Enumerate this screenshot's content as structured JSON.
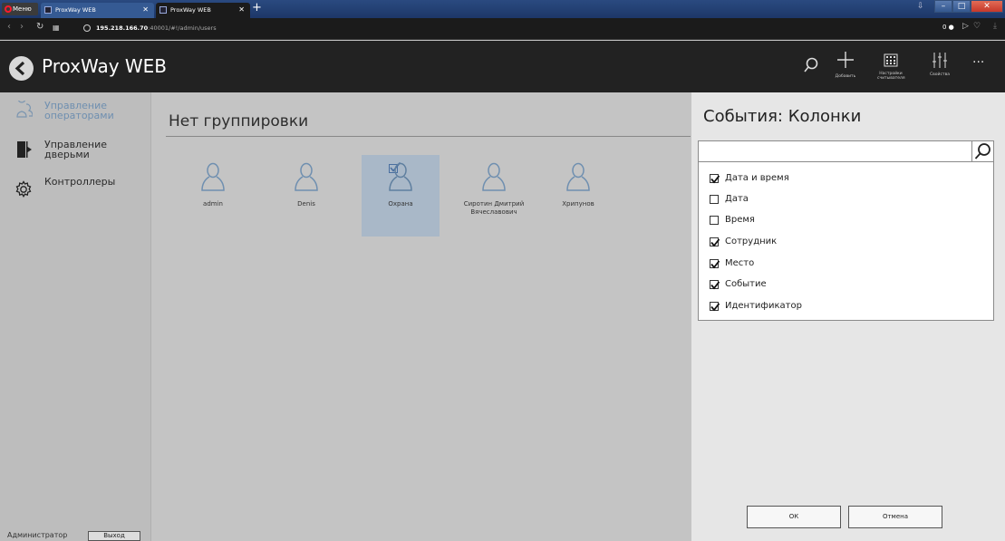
{
  "browser": {
    "menu_label": "Меню",
    "tabs": [
      {
        "title": "ProxWay WEB"
      },
      {
        "title": "ProxWay WEB"
      }
    ],
    "new_tab": "+",
    "address": {
      "host": "195.218.166.70",
      "rest": ":40001/#!/admin/users"
    }
  },
  "app": {
    "title": "ProxWay WEB",
    "toolbar": {
      "search_icon": "search-icon",
      "add_label": "Добавить",
      "reader_label": "Настройки считывателя",
      "props_label": "Свойства",
      "more_label": "···"
    }
  },
  "sidebar": {
    "items": [
      {
        "label": "Управление операторами",
        "icon": "operators-icon",
        "active": true
      },
      {
        "label": "Управление дверьми",
        "icon": "door-icon",
        "active": false
      },
      {
        "label": "Контроллеры",
        "icon": "gear-icon",
        "active": false
      }
    ],
    "footer": {
      "role": "Администратор",
      "logout": "Выход"
    }
  },
  "main": {
    "group_title": "Нет группировки",
    "users": [
      {
        "name": "admin",
        "selected": false
      },
      {
        "name": "Denis",
        "selected": false
      },
      {
        "name": "Охрана",
        "selected": true
      },
      {
        "name": "Сиротин Дмитрий Вячеславович",
        "selected": false
      },
      {
        "name": "Хрипунов",
        "selected": false
      }
    ]
  },
  "panel": {
    "title": "События: Колонки",
    "search_value": "",
    "columns": [
      {
        "label": "Дата и время",
        "checked": true
      },
      {
        "label": "Дата",
        "checked": false
      },
      {
        "label": "Время",
        "checked": false
      },
      {
        "label": "Сотрудник",
        "checked": true
      },
      {
        "label": "Место",
        "checked": true
      },
      {
        "label": "Событие",
        "checked": true
      },
      {
        "label": "Идентификатор",
        "checked": true
      }
    ],
    "ok_label": "ОК",
    "cancel_label": "Отмена"
  },
  "colors": {
    "accent": "#6f8fb0",
    "header_bg": "#222222",
    "selected_tile": "#a9b8c8"
  }
}
